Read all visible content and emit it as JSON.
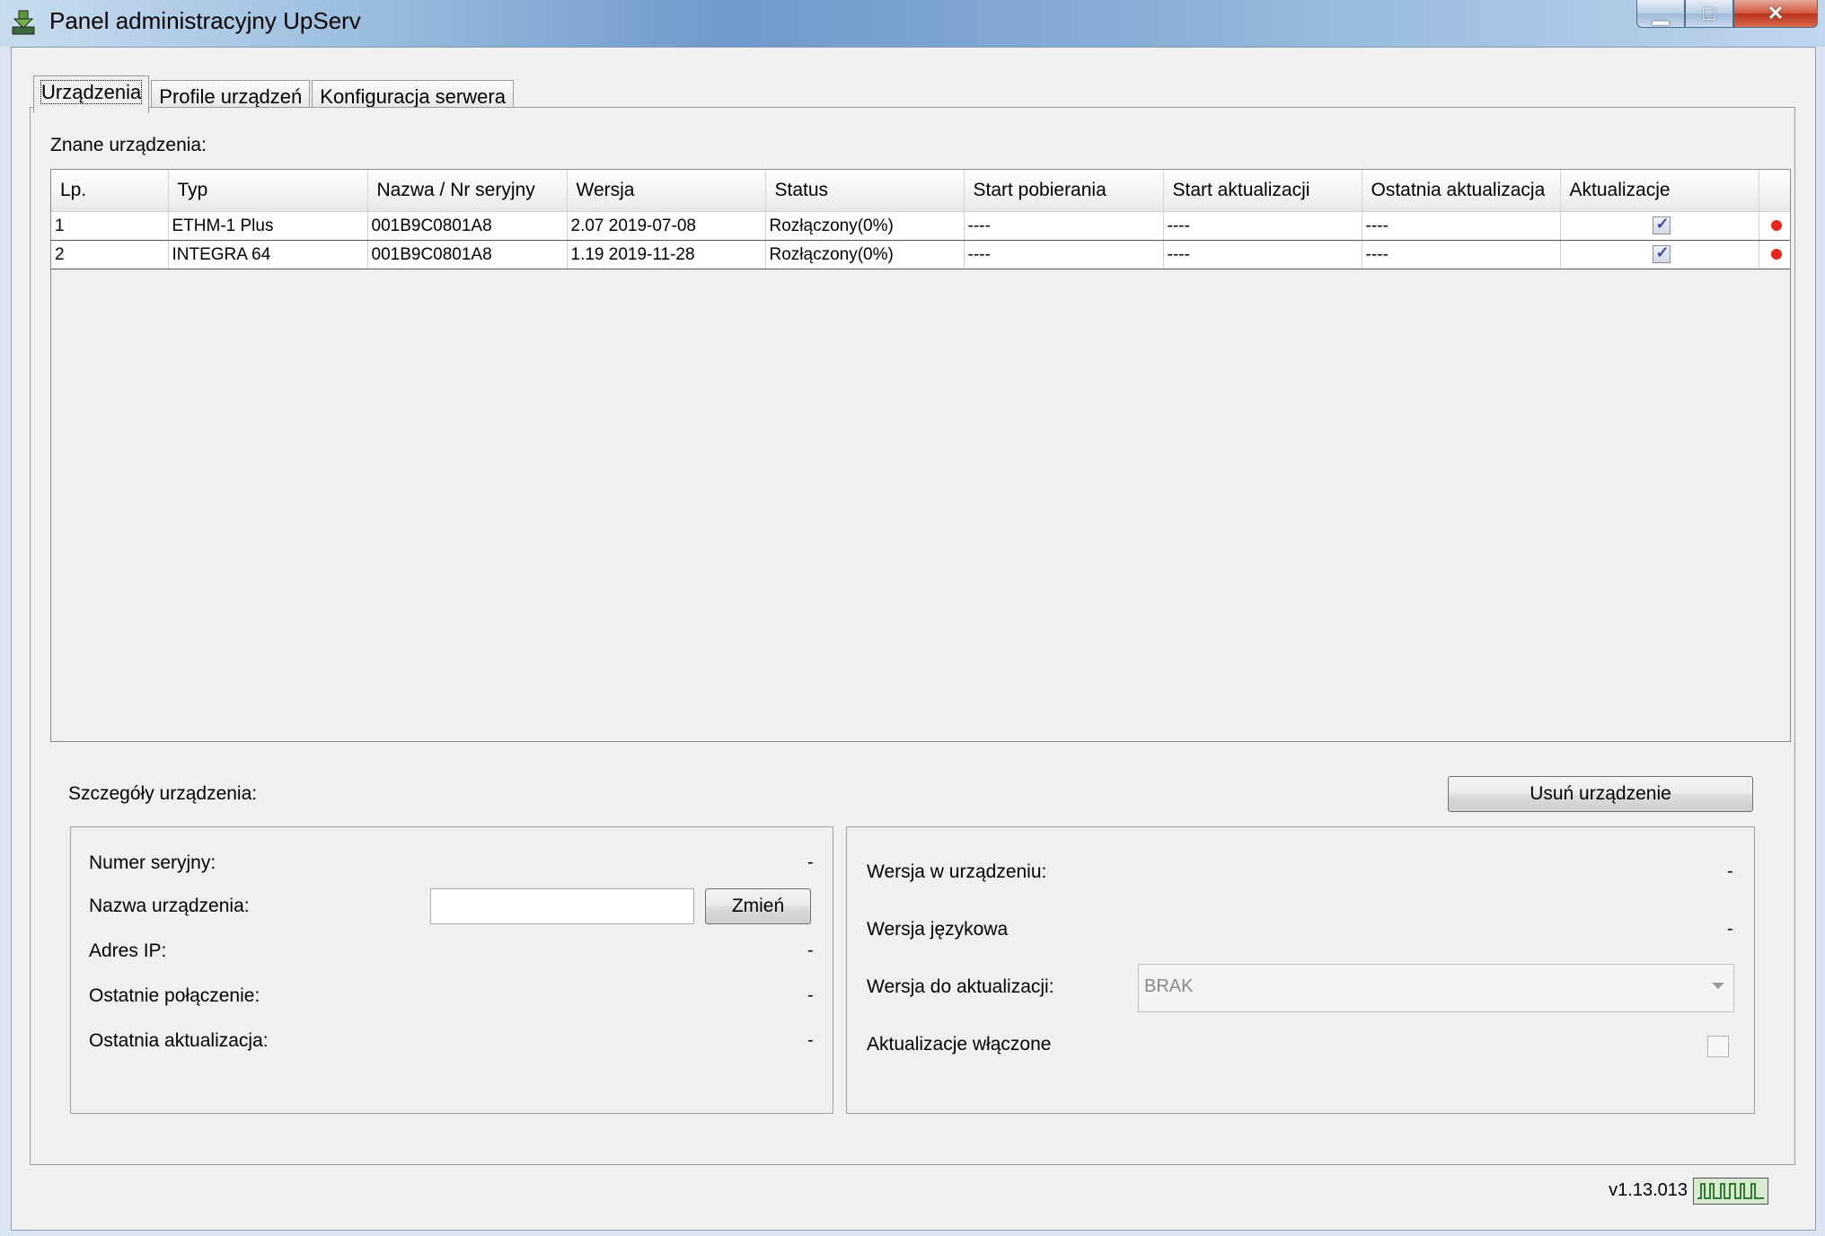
{
  "window": {
    "title": "Panel administracyjny UpServ",
    "minimize": "▁",
    "maximize": "□",
    "close": "✕"
  },
  "tabs": [
    {
      "label": "Urządzenia"
    },
    {
      "label": "Profile urządzeń"
    },
    {
      "label": "Konfiguracja serwera"
    }
  ],
  "devices": {
    "section_label": "Znane urządzenia:",
    "columns": [
      "Lp.",
      "Typ",
      "Nazwa / Nr seryjny",
      "Wersja",
      "Status",
      "Start pobierania",
      "Start aktualizacji",
      "Ostatnia aktualizacja",
      "Aktualizacje"
    ],
    "rows": [
      {
        "lp": "1",
        "type": "ETHM-1 Plus",
        "serial": "001B9C0801A8",
        "version": "2.07 2019-07-08",
        "status": "Rozłączony(0%)",
        "start_download": "----",
        "start_update": "----",
        "last_update": "----",
        "updates": true,
        "indicator": "#e8261a"
      },
      {
        "lp": "2",
        "type": "INTEGRA 64",
        "serial": "001B9C0801A8",
        "version": "1.19 2019-11-28",
        "status": "Rozłączony(0%)",
        "start_download": "----",
        "start_update": "----",
        "last_update": "----",
        "updates": true,
        "indicator": "#e8261a"
      }
    ]
  },
  "details": {
    "section_label": "Szczegóły urządzenia:",
    "remove_button": "Usuń urządzenie",
    "left": {
      "serial_label": "Numer seryjny:",
      "serial_value": "-",
      "name_label": "Nazwa urządzenia:",
      "name_value": "",
      "change_button": "Zmień",
      "ip_label": "Adres IP:",
      "ip_value": "-",
      "last_conn_label": "Ostatnie połączenie:",
      "last_conn_value": "-",
      "last_update_label": "Ostatnia aktualizacja:",
      "last_update_value": "-"
    },
    "right": {
      "device_version_label": "Wersja w urządzeniu:",
      "device_version_value": "-",
      "lang_version_label": "Wersja językowa",
      "lang_version_value": "-",
      "update_version_label": "Wersja do aktualizacji:",
      "update_version_selected": "BRAK",
      "updates_enabled_label": "Aktualizacje włączone",
      "updates_enabled": false
    }
  },
  "footer": {
    "version": "v1.13.013",
    "status_icon": "status-bits-icon"
  }
}
